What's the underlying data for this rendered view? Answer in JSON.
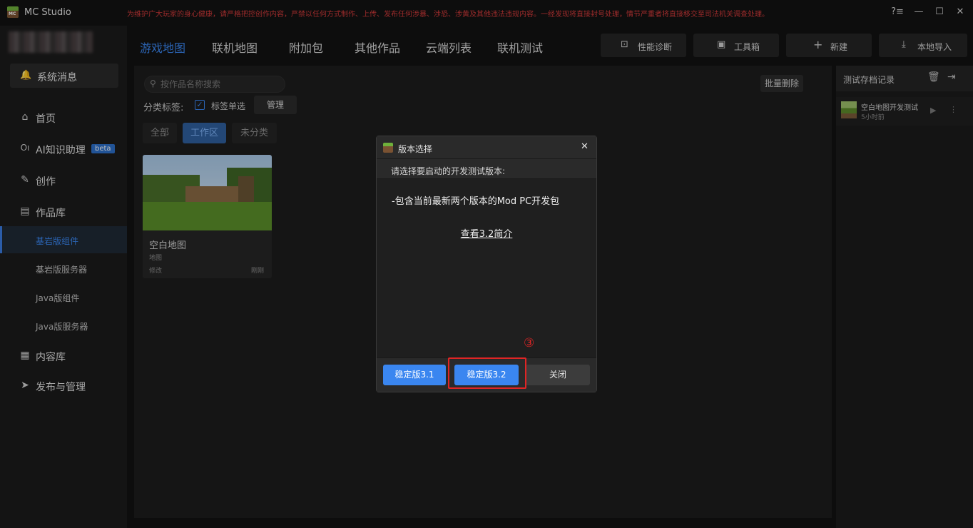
{
  "app": {
    "name": "MC Studio",
    "warning": "为维护广大玩家的身心健康，请严格把控创作内容，严禁以任何方式制作、上传、发布任何涉暴、涉恐、涉黄及其他违法违规内容。一经发现将直接封号处理，情节严重者将直接移交至司法机关调查处理。",
    "window_controls": {
      "help": "?≡",
      "minimize": "—",
      "maximize": "☐",
      "close": "✕"
    }
  },
  "sidebar": {
    "system_message": "系统消息",
    "items": [
      {
        "label": "首页",
        "icon": "home-icon"
      },
      {
        "label": "AI知识助理",
        "icon": "ai-icon",
        "badge": "beta"
      },
      {
        "label": "创作",
        "icon": "pen-icon"
      },
      {
        "label": "作品库",
        "icon": "library-icon"
      }
    ],
    "sub_items": [
      "基岩版组件",
      "基岩版服务器",
      "Java版组件",
      "Java版服务器"
    ],
    "bottom_items": [
      {
        "label": "内容库",
        "icon": "grid-icon"
      },
      {
        "label": "发布与管理",
        "icon": "send-icon"
      }
    ]
  },
  "tabs": [
    "游戏地图",
    "联机地图",
    "附加包",
    "其他作品",
    "云端列表",
    "联机测试"
  ],
  "toolbar": {
    "diagnose": "性能诊断",
    "toolbox": "工具箱",
    "new": "新建",
    "import": "本地导入"
  },
  "content": {
    "search_placeholder": "按作品名称搜索",
    "category_label": "分类标签:",
    "single_select": "标签单选",
    "manage": "管理",
    "batch_delete": "批量删除",
    "filters": [
      "全部",
      "工作区",
      "未分类"
    ],
    "card": {
      "title": "空白地图",
      "type": "地图",
      "modified_label": "修改",
      "modified_time": "刚刚"
    }
  },
  "right_panel": {
    "title": "测试存档记录",
    "record": {
      "name": "空白地图开发测试",
      "time": "5小时前"
    }
  },
  "dialog": {
    "title": "版本选择",
    "prompt": "请选择要启动的开发测试版本:",
    "description": "-包含当前最新两个版本的Mod PC开发包",
    "link": "查看3.2简介",
    "buttons": {
      "v31": "稳定版3.1",
      "v32": "稳定版3.2",
      "close": "关闭"
    }
  },
  "annotation": {
    "step": "③"
  },
  "colors": {
    "accent": "#3a86f0",
    "warning": "#d23a3a",
    "highlight": "#e02525"
  }
}
